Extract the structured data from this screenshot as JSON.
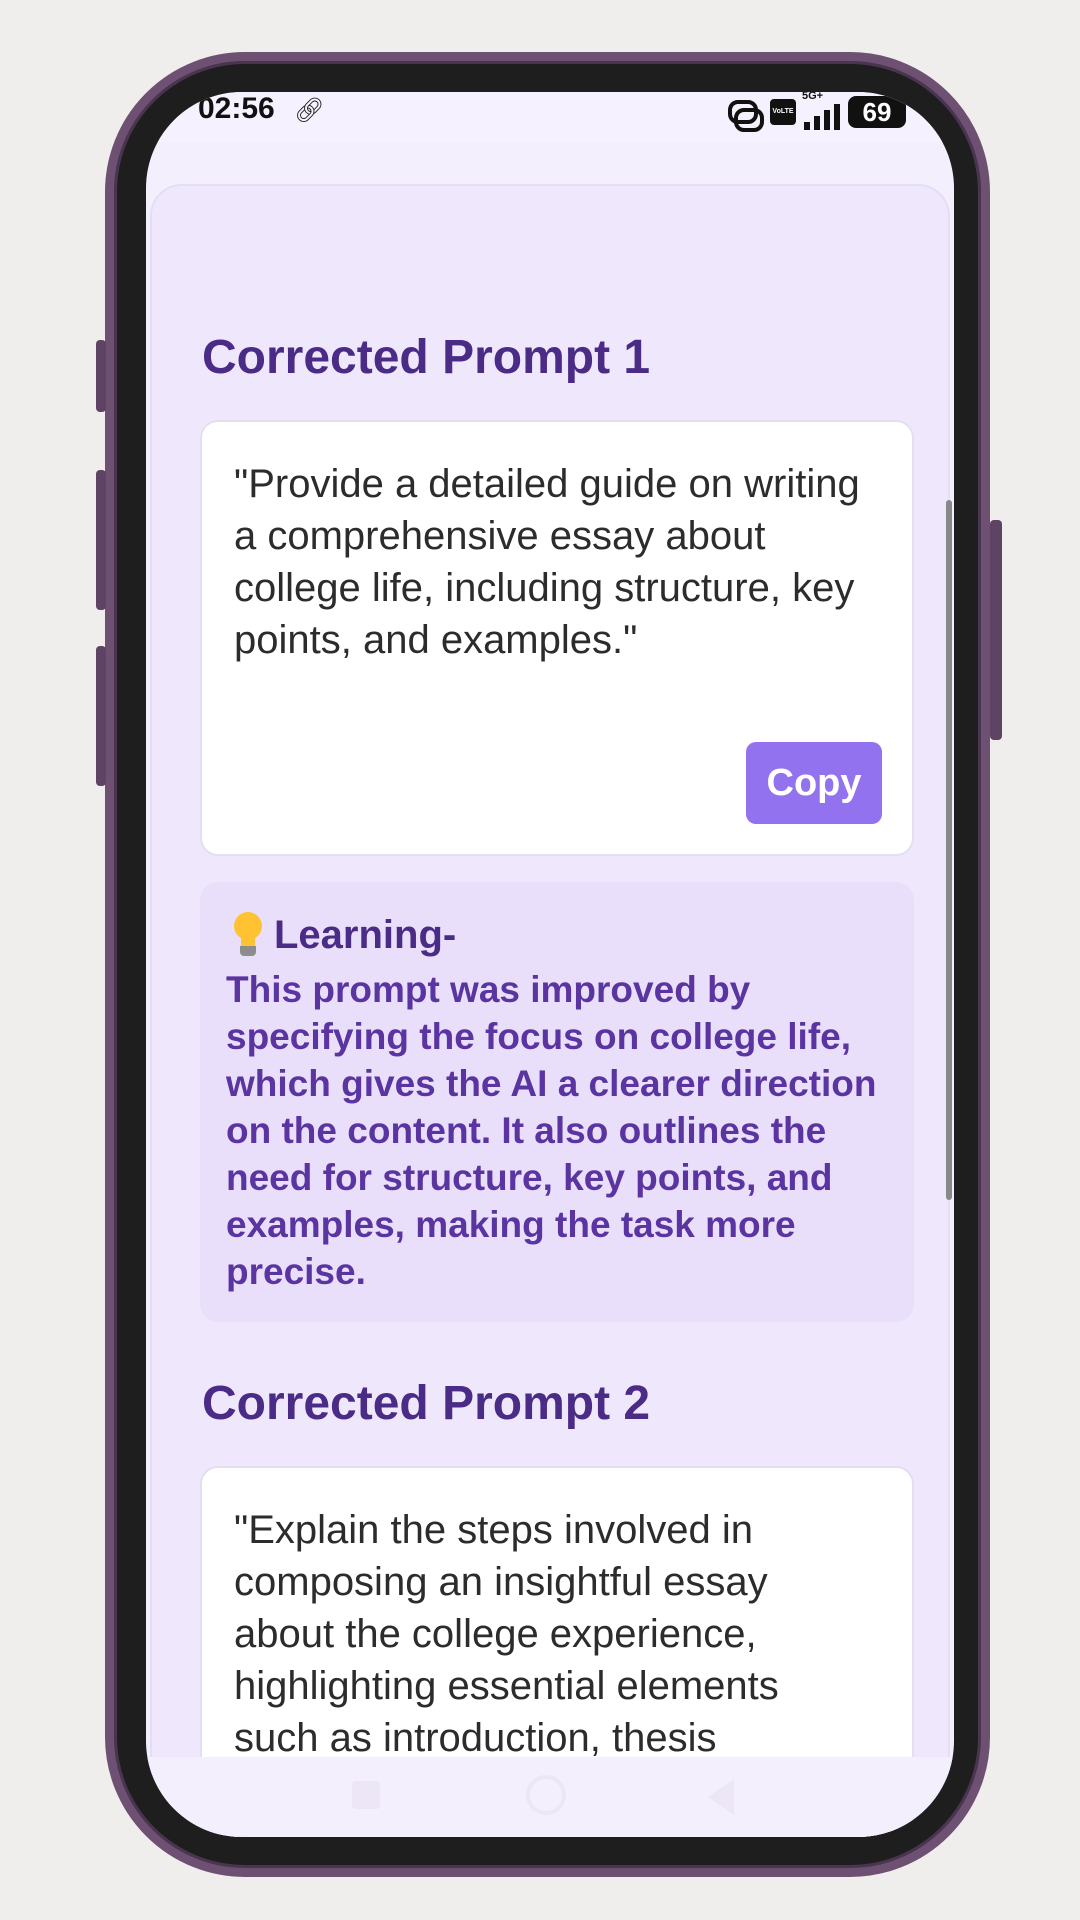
{
  "status_bar": {
    "time": "02:56",
    "network": "5G+",
    "volte": "VoLTE",
    "battery": "69"
  },
  "sections": [
    {
      "title": "Corrected Prompt 1",
      "prompt": "\"Provide a detailed guide on writing a comprehensive essay about college life, including structure, key points, and examples.\"",
      "copy_label": "Copy",
      "learning_label": "Learning-",
      "learning_text": "This prompt was improved by specifying the focus on college life, which gives the AI a clearer direction on the content. It also outlines the need for structure, key points, and examples, making the task more precise."
    },
    {
      "title": "Corrected Prompt 2",
      "prompt": "\"Explain the steps involved in composing an insightful essay about the college experience, highlighting essential elements such as introduction, thesis statement, supporting arguments, and conclusion.\""
    }
  ],
  "icons": {
    "link": "link-icon",
    "dual_app": "dual-app-icon",
    "signal": "signal-icon",
    "bulb": "lightbulb-icon"
  }
}
